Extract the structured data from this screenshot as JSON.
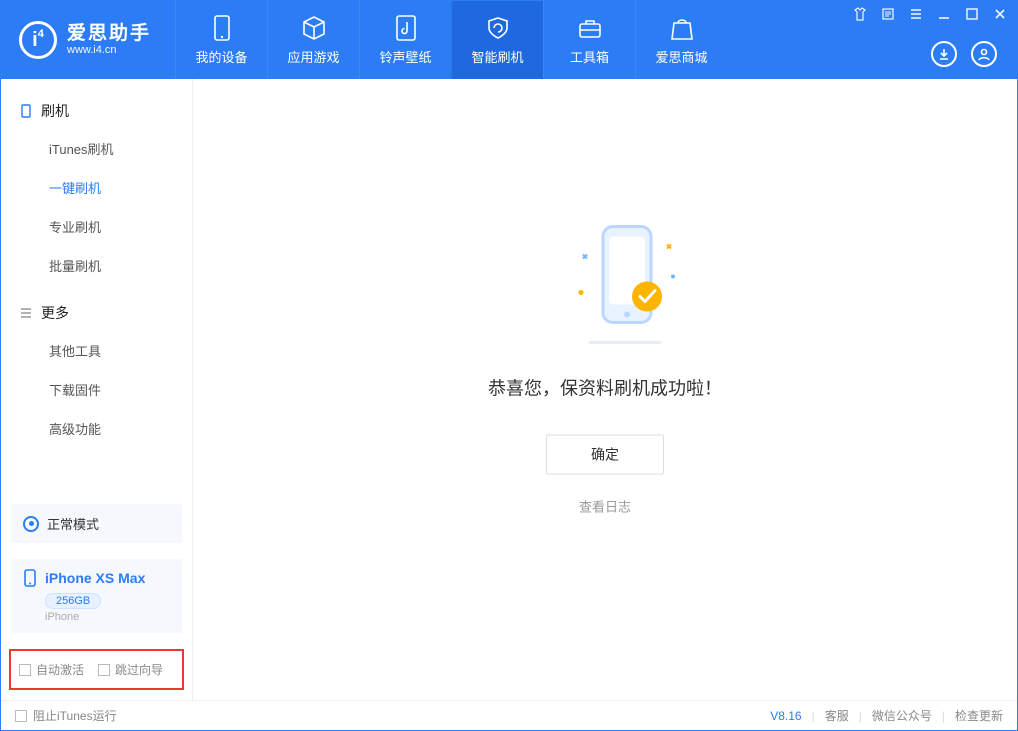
{
  "app": {
    "name_cn": "爱思助手",
    "name_en": "www.i4.cn"
  },
  "nav": [
    {
      "label": "我的设备"
    },
    {
      "label": "应用游戏"
    },
    {
      "label": "铃声壁纸"
    },
    {
      "label": "智能刷机"
    },
    {
      "label": "工具箱"
    },
    {
      "label": "爱思商城"
    }
  ],
  "sidebar": {
    "group1_title": "刷机",
    "group1_items": [
      "iTunes刷机",
      "一键刷机",
      "专业刷机",
      "批量刷机"
    ],
    "group2_title": "更多",
    "group2_items": [
      "其他工具",
      "下载固件",
      "高级功能"
    ]
  },
  "mode": {
    "label": "正常模式"
  },
  "device": {
    "name": "iPhone XS Max",
    "capacity": "256GB",
    "type": "iPhone"
  },
  "checks": {
    "auto_activate": "自动激活",
    "skip_guide": "跳过向导"
  },
  "main": {
    "success_title": "恭喜您，保资料刷机成功啦！",
    "confirm": "确定",
    "view_log": "查看日志"
  },
  "footer": {
    "block_itunes": "阻止iTunes运行",
    "version": "V8.16",
    "links": [
      "客服",
      "微信公众号",
      "检查更新"
    ]
  }
}
